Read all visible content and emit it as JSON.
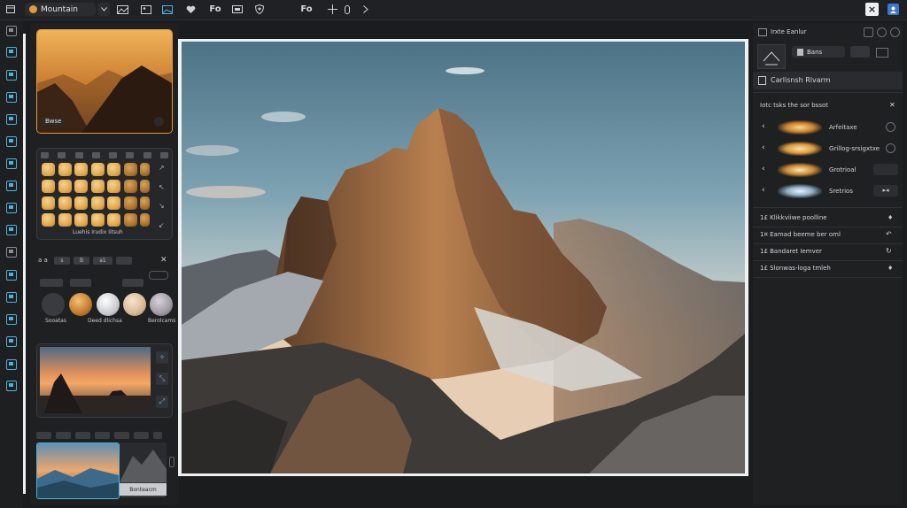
{
  "topbar": {
    "title": "Mountain",
    "icons": [
      "window-icon",
      "dropdown-icon",
      "gallery-icon",
      "image-icon",
      "heart-icon",
      "fo-label",
      "layout-icon",
      "shield-icon",
      "fo-label-2",
      "crop-icon",
      "rotate-icon",
      "next-icon"
    ],
    "fo_label": "Fo",
    "fo_label_2": "Fo",
    "close_label": "×"
  },
  "left_panel": {
    "preview_label": "Bwse",
    "grid_caption": "Luehis Irudix Iitsuh",
    "pill_labels": [
      "a a",
      "s",
      "B",
      "a1"
    ],
    "filter_buttons": [
      "",
      "",
      ""
    ],
    "orb_labels": [
      "Sooatas",
      "Deed dlichsa",
      "Berolcams"
    ],
    "thumb_tabs": [
      "",
      "",
      "",
      "",
      "",
      "",
      ""
    ],
    "thumb_caption": "Bonteacm"
  },
  "right_panel": {
    "header_title": "Irxte Eanlur",
    "header_button": "Bans",
    "section_title": "Carlisnsh Rlvarm",
    "sub_title": "Iotc tsks the sor bssot",
    "adjustments": [
      {
        "label": "Arfeitaxe"
      },
      {
        "label": "Grillog-srsigxtxe"
      },
      {
        "label": "Grotrioal"
      },
      {
        "label": "Sretrios"
      }
    ],
    "list_items": [
      {
        "label": "1£ Klikkviiwe poolline"
      },
      {
        "label": "1¤ Eamad beeme ber oml"
      },
      {
        "label": "1£ Bandaret Iemver"
      },
      {
        "label": "1£ Slonwas-loga tmleh"
      }
    ]
  },
  "colors": {
    "accent": "#4fb2d8",
    "background": "#1b1c1e",
    "panel": "#1f2022",
    "highlight_orange": "#e39a3c"
  }
}
